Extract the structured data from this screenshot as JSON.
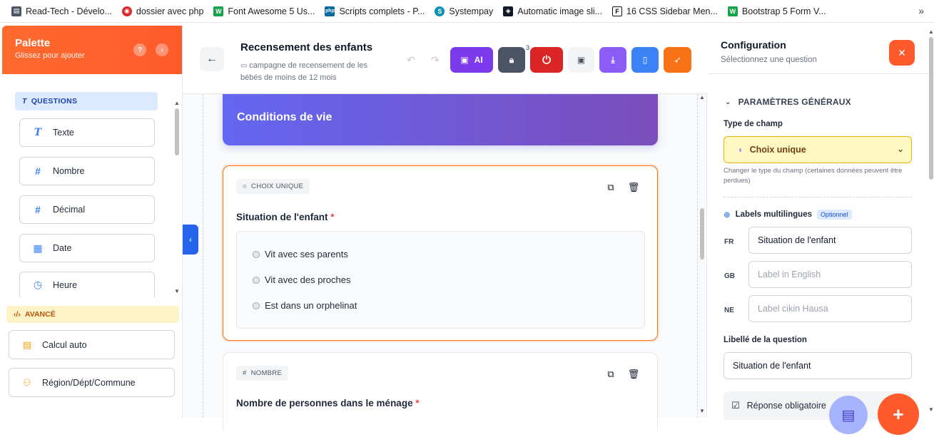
{
  "bookmarks": [
    {
      "label": "Read-Tech - Dévelo...",
      "icon": "document-icon",
      "color": "#374151"
    },
    {
      "label": "dossier avec php",
      "icon": "tutoriel-icon",
      "color": "#dc2626"
    },
    {
      "label": "Font Awesome 5 Us...",
      "icon": "w3-icon",
      "color": "#16a34a"
    },
    {
      "label": "Scripts complets - P...",
      "icon": "php-icon",
      "color": "#0369a1"
    },
    {
      "label": "Systempay",
      "icon": "systempay-icon",
      "color": "#0891b2"
    },
    {
      "label": "Automatic image sli...",
      "icon": "layers-icon",
      "color": "#111827"
    },
    {
      "label": "16 CSS Sidebar Men...",
      "icon": "f-icon",
      "color": "#111827"
    },
    {
      "label": "Bootstrap 5 Form V...",
      "icon": "w3-icon",
      "color": "#16a34a"
    }
  ],
  "palette": {
    "title": "Palette",
    "subtitle": "Glissez pour ajouter",
    "help_icon": "?",
    "questions_section": "QUESTIONS",
    "items": [
      {
        "label": "Texte",
        "icon": "T"
      },
      {
        "label": "Nombre",
        "icon": "#"
      },
      {
        "label": "Décimal",
        "icon": "#"
      },
      {
        "label": "Date",
        "icon": "▦"
      },
      {
        "label": "Heure",
        "icon": "◷"
      }
    ],
    "advanced_section": "AVANCÉ",
    "advanced_items": [
      {
        "label": "Calcul auto",
        "icon": "▤"
      },
      {
        "label": "Région/Dépt/Commune",
        "icon": "⚇"
      }
    ]
  },
  "form": {
    "title": "Recensement des enfants",
    "description": "campagne de recensement de les bébés de moins de 12 mois",
    "ai_label": "AI",
    "lock_badge": "3"
  },
  "canvas": {
    "section_title": "Conditions de vie",
    "cards": [
      {
        "type_tag": "CHOIX UNIQUE",
        "question": "Situation de l'enfant",
        "required_mark": "*",
        "options": [
          "Vit avec ses parents",
          "Vit avec des proches",
          "Est dans un orphelinat"
        ]
      },
      {
        "type_tag": "NOMBRE",
        "question": "Nombre de personnes dans le ménage",
        "required_mark": "*"
      }
    ]
  },
  "config": {
    "title": "Configuration",
    "subtitle": "Sélectionnez une question",
    "section": "PARAMÈTRES GÉNÉRAUX",
    "field_type_label": "Type de champ",
    "field_type_value": "Choix unique",
    "field_type_help": "Changer le type du champ (certaines données peuvent être perdues)",
    "ml_label": "Labels multilingues",
    "ml_badge": "Optionnel",
    "languages": [
      {
        "code": "FR",
        "value": "Situation de l'enfant",
        "placeholder": ""
      },
      {
        "code": "GB",
        "value": "",
        "placeholder": "Label in English"
      },
      {
        "code": "NE",
        "value": "",
        "placeholder": "Label cikin Hausa"
      }
    ],
    "question_label": "Libellé de la question",
    "question_value": "Situation de l'enfant",
    "required_label": "Réponse obligatoire"
  },
  "colors": {
    "accent_orange": "#ff5a2b",
    "ai_purple": "#7c3aed",
    "lock_gray": "#4b5563",
    "reset_red": "#dc2626",
    "download_purple": "#8b5cf6",
    "mobile_blue": "#3b82f6"
  }
}
